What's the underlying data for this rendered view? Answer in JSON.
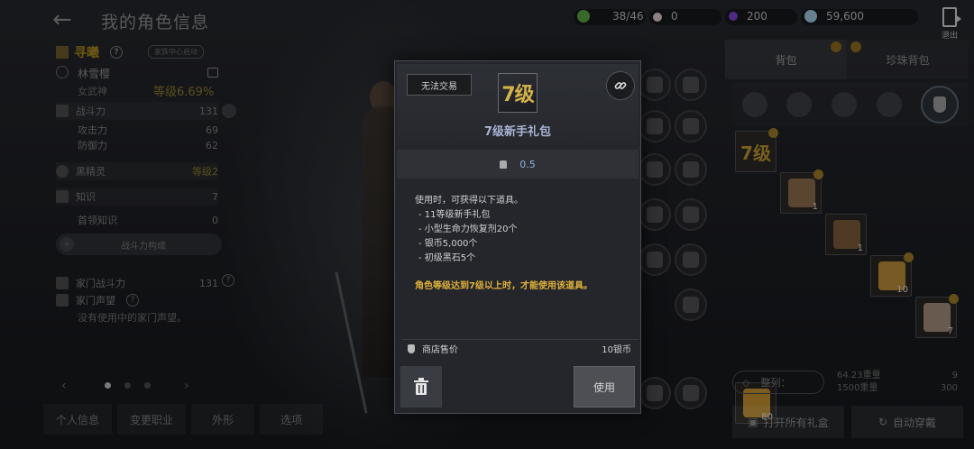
{
  "header": {
    "title": "我的角色信息"
  },
  "resources": [
    {
      "value": "38/46",
      "icon": "energy-icon",
      "color": "#5aa040"
    },
    {
      "value": "0",
      "icon": "pearl-icon",
      "color": "#d9c7c7"
    },
    {
      "value": "200",
      "icon": "purple-gem-icon",
      "color": "#7a3fc8"
    },
    {
      "value": "59,600",
      "icon": "silver-coin-icon",
      "color": "#9fc7df"
    }
  ],
  "exit": {
    "label": "退出"
  },
  "character": {
    "family": "寻曦",
    "family_tag": "家族中心启动",
    "name": "林雪樱",
    "class": "女武神",
    "level": "等级6.69%"
  },
  "stats": [
    {
      "label": "战斗力",
      "value": "131"
    },
    {
      "label": "攻击力",
      "value": "69"
    },
    {
      "label": "防御力",
      "value": "62"
    },
    {
      "label": "黑精灵",
      "value": "等级2"
    },
    {
      "label": "知识",
      "value": "7"
    },
    {
      "label": "首领知识",
      "value": "0"
    }
  ],
  "combat_power_button": "战斗力构成",
  "family_stats": [
    {
      "label": "家门战斗力",
      "value": "131"
    },
    {
      "label": "家门声望",
      "value": ""
    }
  ],
  "no_fame_text": "没有使用中的家门声望。",
  "bottom_tabs": [
    "个人信息",
    "变更职业",
    "外形",
    "选项"
  ],
  "inventory": {
    "tabs": [
      "背包",
      "珍珠背包"
    ],
    "items": [
      {
        "label": "7级",
        "count": "",
        "color": "#3a3020"
      },
      {
        "label": "",
        "count": "1",
        "color": "#8a6a4a"
      },
      {
        "label": "",
        "count": "1",
        "color": "#7a5a3a"
      },
      {
        "label": "",
        "count": "10",
        "color": "#b88a3a"
      },
      {
        "label": "",
        "count": "7",
        "color": "#a08a7a"
      },
      {
        "label": "",
        "count": "80",
        "color": "#c09030"
      }
    ],
    "sort_label": "整列：",
    "weight_current": "64.23重量",
    "weight_max": "1500重量",
    "slots_used": "9",
    "slots_max": "300",
    "open_all": "打开所有礼盒",
    "auto_equip": "自动穿戴"
  },
  "modal": {
    "untradable": "无法交易",
    "icon_text": "7级",
    "title": "7级新手礼包",
    "weight": "0.5",
    "desc": [
      "使用时，可获得以下道具。",
      "- 11等级新手礼包",
      "- 小型生命力恢复剂20个",
      "- 银币5,000个",
      "- 初级黑石5个"
    ],
    "condition": "角色等级达到7级以上时，才能使用该道具。",
    "price_label": "商店售价",
    "price_value": "10银币",
    "use_label": "使用"
  }
}
